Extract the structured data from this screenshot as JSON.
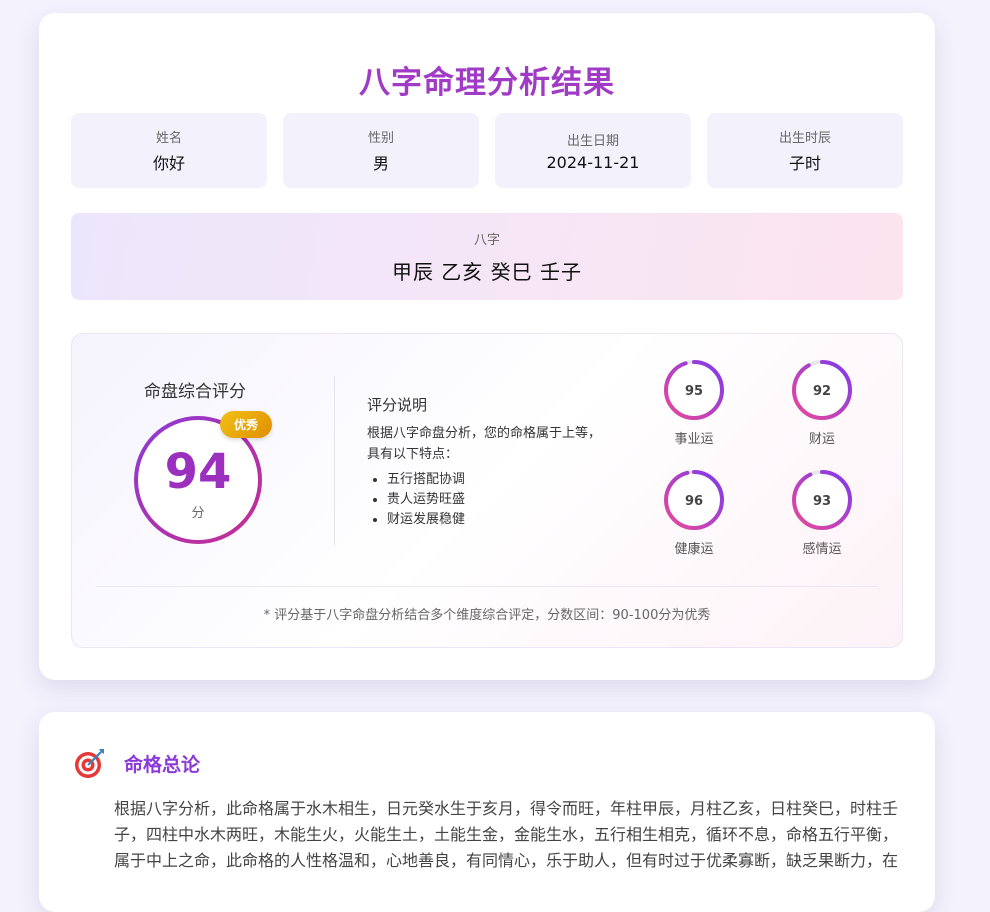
{
  "title": "八字命理分析结果",
  "info": [
    {
      "label": "姓名",
      "value": "你好"
    },
    {
      "label": "性别",
      "value": "男"
    },
    {
      "label": "出生日期",
      "value": "2024-11-21"
    },
    {
      "label": "出生时辰",
      "value": "子时"
    }
  ],
  "bazi": {
    "label": "八字",
    "value": "甲辰 乙亥 癸巳 壬子"
  },
  "score": {
    "title": "命盘综合评分",
    "value": "94",
    "unit": "分",
    "badge": "优秀",
    "desc_title": "评分说明",
    "desc_text": "根据八字命盘分析，您的命格属于上等，具有以下特点：",
    "points": [
      "五行搭配协调",
      "贵人运势旺盛",
      "财运发展稳健"
    ],
    "subscores": [
      {
        "label": "事业运",
        "value": 95
      },
      {
        "label": "财运",
        "value": 92
      },
      {
        "label": "健康运",
        "value": 96
      },
      {
        "label": "感情运",
        "value": 93
      }
    ],
    "footnote": "* 评分基于八字命盘分析结合多个维度综合评定，分数区间：90-100分为优秀"
  },
  "summary": {
    "icon": "target-icon",
    "title": "命格总论",
    "text": "根据八字分析，此命格属于水木相生，日元癸水生于亥月，得令而旺，年柱甲辰，月柱乙亥，日柱癸巳，时柱壬子，四柱中水木两旺，木能生火，火能生土，土能生金，金能生水，五行相生相克，循环不息，命格五行平衡，属于中上之命，此命格的人性格温和，心地善良，有同情心，乐于助人，但有时过于优柔寡断，缺乏果断力，在"
  },
  "colors": {
    "accent": "#a03bc6",
    "ring_start": "#8c3ad6",
    "ring_end": "#c72d8f",
    "badge": "#e9a90c"
  }
}
